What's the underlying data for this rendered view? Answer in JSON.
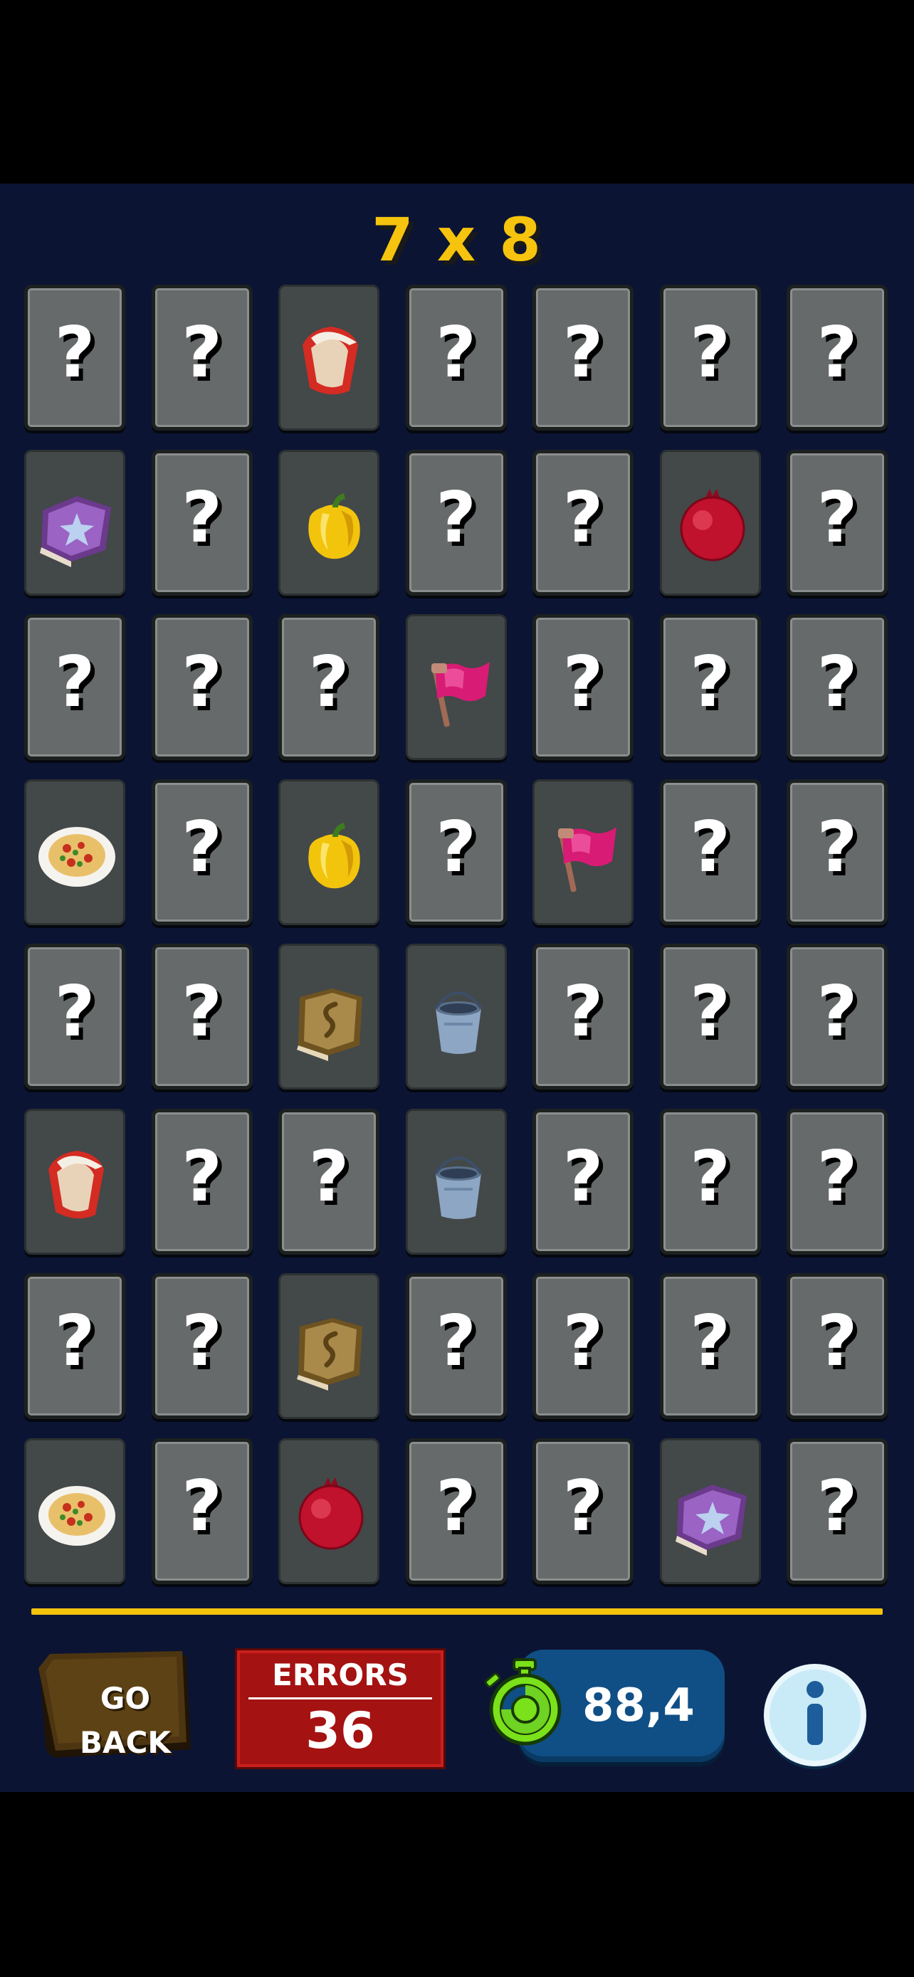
{
  "game": {
    "title": "7 x 8",
    "hidden_symbol": "?",
    "grid": [
      [
        "hidden",
        "hidden",
        "bag",
        "hidden",
        "hidden",
        "hidden",
        "hidden"
      ],
      [
        "spellbook",
        "hidden",
        "pepper",
        "hidden",
        "hidden",
        "pomegranate",
        "hidden"
      ],
      [
        "hidden",
        "hidden",
        "hidden",
        "flag",
        "hidden",
        "hidden",
        "hidden"
      ],
      [
        "pizza",
        "hidden",
        "pepper",
        "hidden",
        "flag",
        "hidden",
        "hidden"
      ],
      [
        "hidden",
        "hidden",
        "brown-book",
        "bucket",
        "hidden",
        "hidden",
        "hidden"
      ],
      [
        "bag",
        "hidden",
        "hidden",
        "bucket",
        "hidden",
        "hidden",
        "hidden"
      ],
      [
        "hidden",
        "hidden",
        "brown-book",
        "hidden",
        "hidden",
        "hidden",
        "hidden"
      ],
      [
        "pizza",
        "hidden",
        "pomegranate",
        "hidden",
        "hidden",
        "spellbook",
        "hidden"
      ]
    ]
  },
  "footer": {
    "go_back_line1": "GO",
    "go_back_line2": "BACK",
    "errors_label": "ERRORS",
    "errors_value": "36",
    "timer_value": "88,4",
    "timer_icon": "stopwatch-icon",
    "info_icon": "info-icon"
  },
  "colors": {
    "background": "#0c1434",
    "title": "#f6c40e",
    "divider": "#f5c20c",
    "errors_panel": "#a51212",
    "timer_pill": "#0f4f86",
    "stopwatch": "#7ae11a",
    "card_hidden": "#666a6a",
    "card_revealed": "#434849"
  }
}
